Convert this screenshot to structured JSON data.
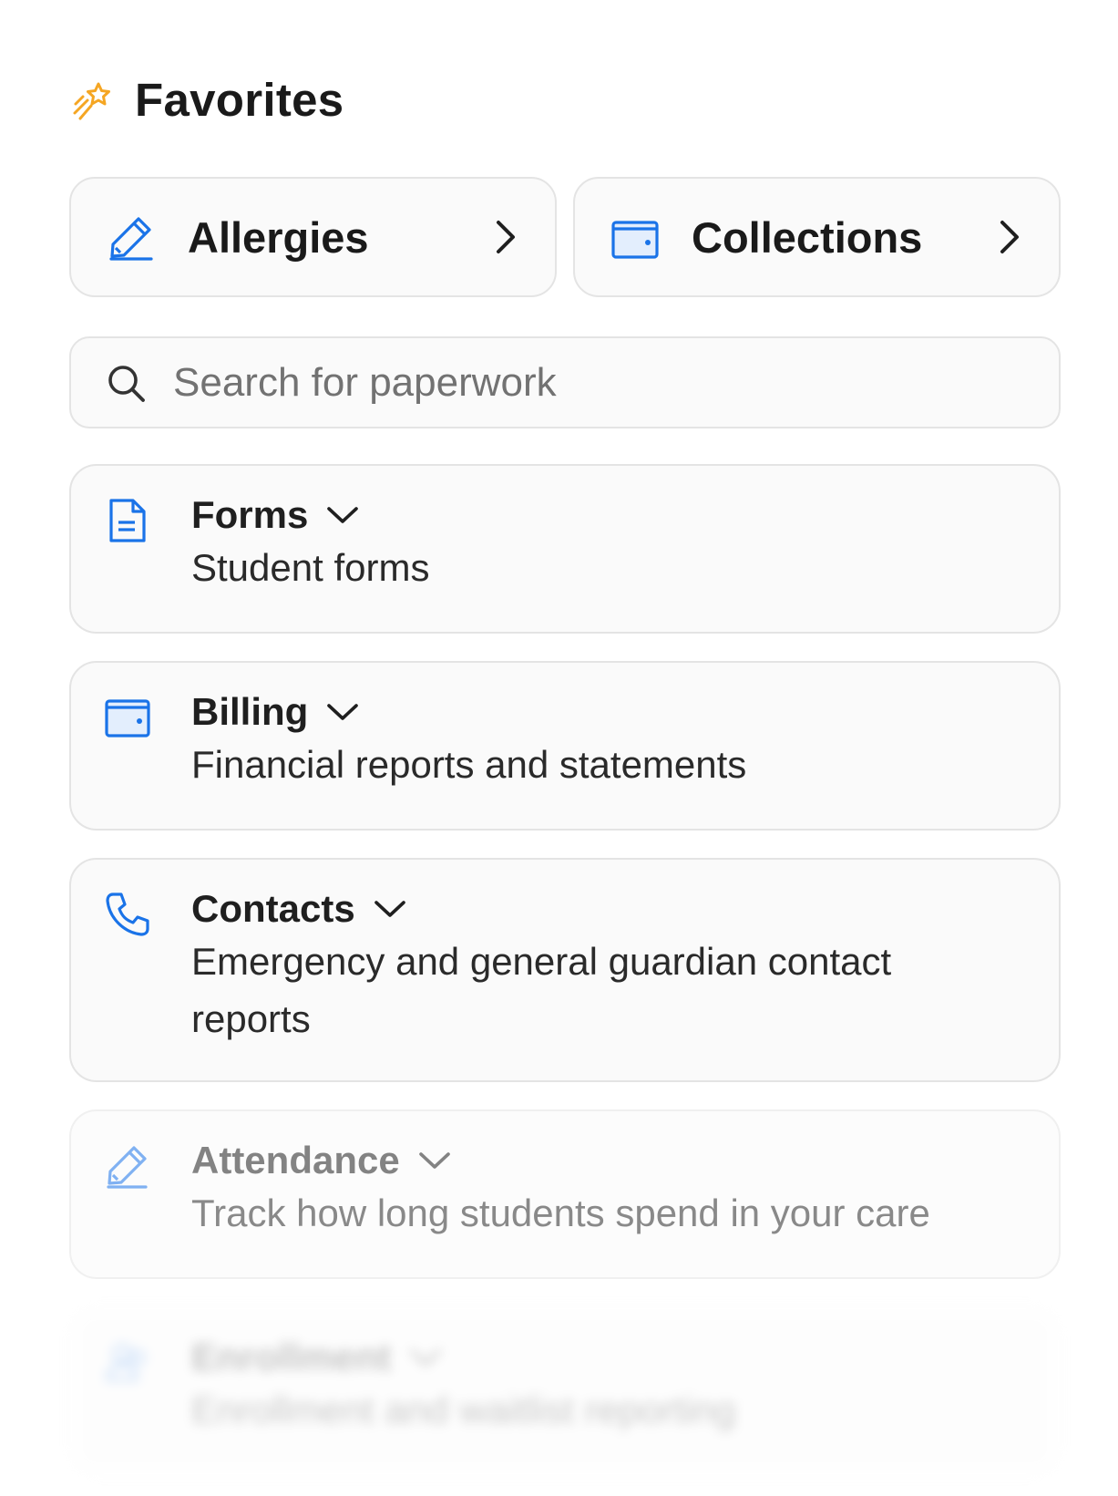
{
  "favorites": {
    "title": "Favorites",
    "icon": "shooting-star-icon",
    "items": [
      {
        "label": "Allergies",
        "icon": "pencil-icon"
      },
      {
        "label": "Collections",
        "icon": "wallet-icon"
      }
    ]
  },
  "search": {
    "placeholder": "Search for paperwork",
    "icon": "search-icon"
  },
  "categories": [
    {
      "title": "Forms",
      "description": "Student forms",
      "icon": "document-icon"
    },
    {
      "title": "Billing",
      "description": "Financial reports and statements",
      "icon": "wallet-icon"
    },
    {
      "title": "Contacts",
      "description": "Emergency and general guardian contact reports",
      "icon": "phone-icon"
    },
    {
      "title": "Attendance",
      "description": "Track how long students spend in your care",
      "icon": "pencil-icon"
    },
    {
      "title": "Enrollment",
      "description": "Enrollment and waitlist reporting",
      "icon": "users-icon"
    }
  ],
  "colors": {
    "accent": "#1a73e8",
    "star": "#f5a623",
    "card_border": "#e4e4e4",
    "card_background": "#fafafa"
  }
}
